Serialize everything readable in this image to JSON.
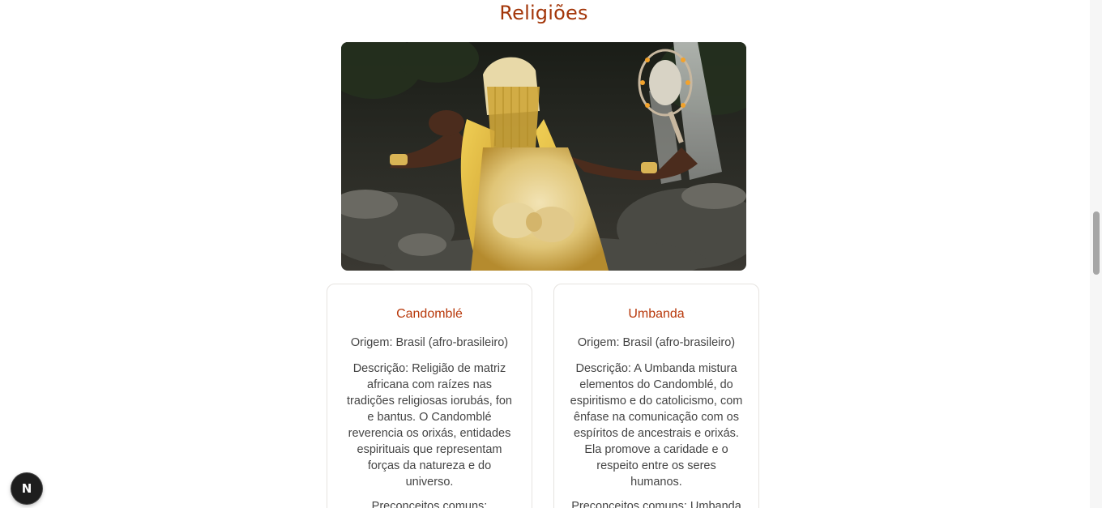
{
  "section": {
    "title": "Religiões"
  },
  "hero": {
    "icon": "orisha-photo"
  },
  "cards": [
    {
      "title": "Candomblé",
      "origin": "Origem: Brasil (afro-brasileiro)",
      "description": "Descrição: Religião de matriz africana com raízes nas tradições religiosas iorubás, fon e bantus. O Candomblé reverencia os orixás, entidades espirituais que representam forças da natureza e do universo.",
      "prejudice": "Preconceitos comuns:"
    },
    {
      "title": "Umbanda",
      "origin": "Origem: Brasil (afro-brasileiro)",
      "description": "Descrição: A Umbanda mistura elementos do Candomblé, do espiritismo e do catolicismo, com ênfase na comunicação com os espíritos de ancestrais e orixás. Ela promove a caridade e o respeito entre os seres humanos.",
      "prejudice": "Preconceitos comuns: Umbanda"
    }
  ],
  "dev_badge": {
    "label": "N"
  },
  "colors": {
    "accent": "#b8380a",
    "text": "#444444",
    "border": "#e6e3e0"
  }
}
